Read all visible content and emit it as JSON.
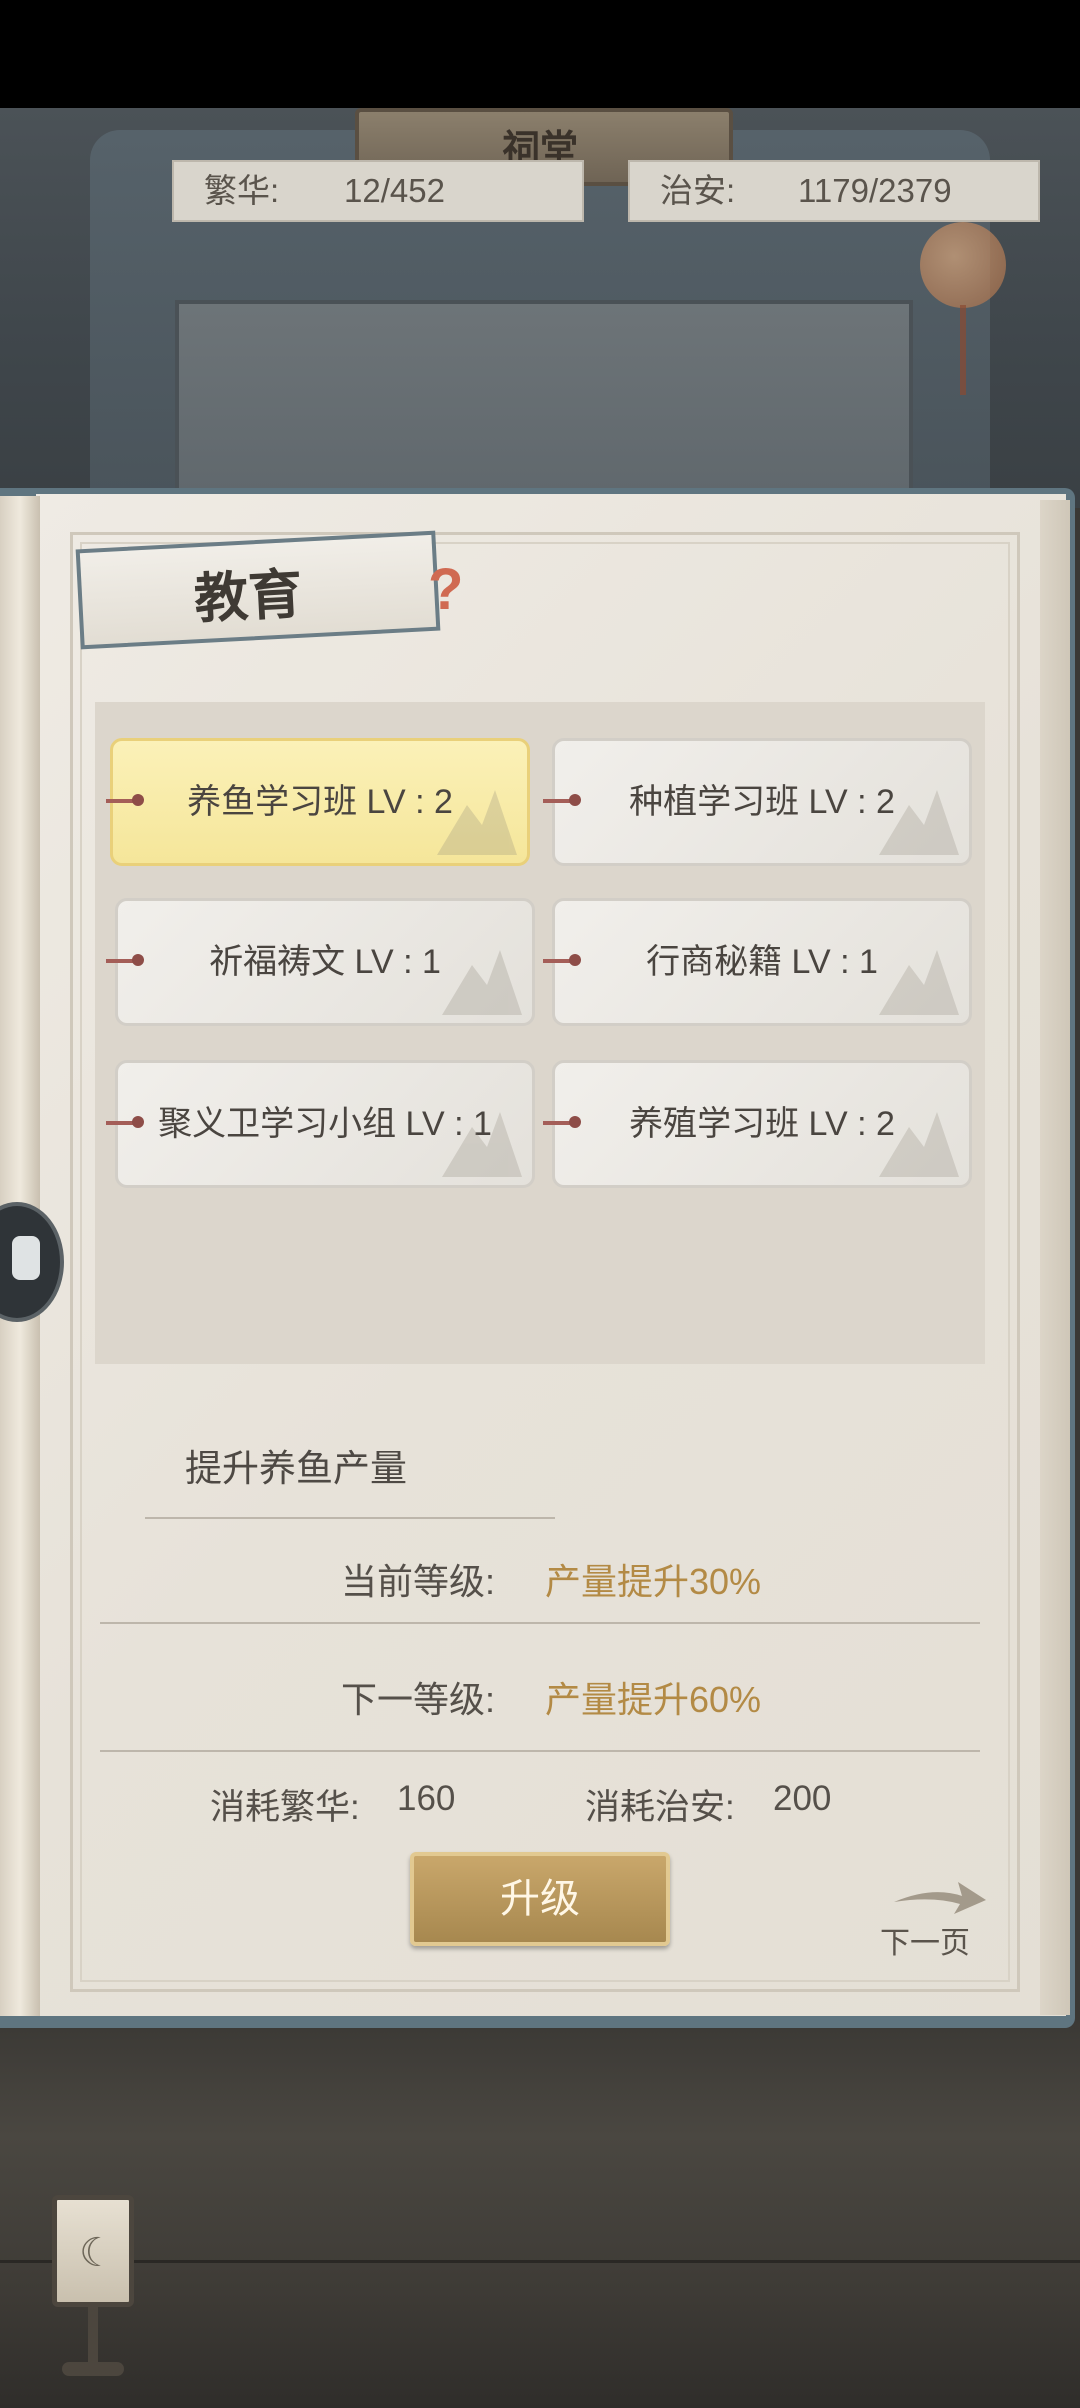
{
  "hall": {
    "sign": "祠堂"
  },
  "stats": {
    "prosperity": {
      "label": "繁华:",
      "value": "12/452"
    },
    "security": {
      "label": "治安:",
      "value": "1179/2379"
    }
  },
  "page": {
    "title": "教育",
    "help": "?"
  },
  "skills": [
    {
      "label": "养鱼学习班 LV : 2"
    },
    {
      "label": "种植学习班 LV : 2"
    },
    {
      "label": "祈福祷文 LV : 1"
    },
    {
      "label": "行商秘籍 LV : 1"
    },
    {
      "label": "聚义卫学习小组 LV : 1"
    },
    {
      "label": "养殖学习班 LV : 2"
    }
  ],
  "detail": {
    "title": "提升养鱼产量",
    "current_label": "当前等级:",
    "current_value": "产量提升30%",
    "next_label": "下一等级:",
    "next_value": "产量提升60%",
    "cost_prosperity_label": "消耗繁华:",
    "cost_prosperity_value": "160",
    "cost_security_label": "消耗治安:",
    "cost_security_value": "200"
  },
  "actions": {
    "upgrade": "升级",
    "next_page": "下一页"
  },
  "colors": {
    "accent_gold": "#b38a45",
    "selected_card": "#f5e69a",
    "button": "#b8975c"
  }
}
